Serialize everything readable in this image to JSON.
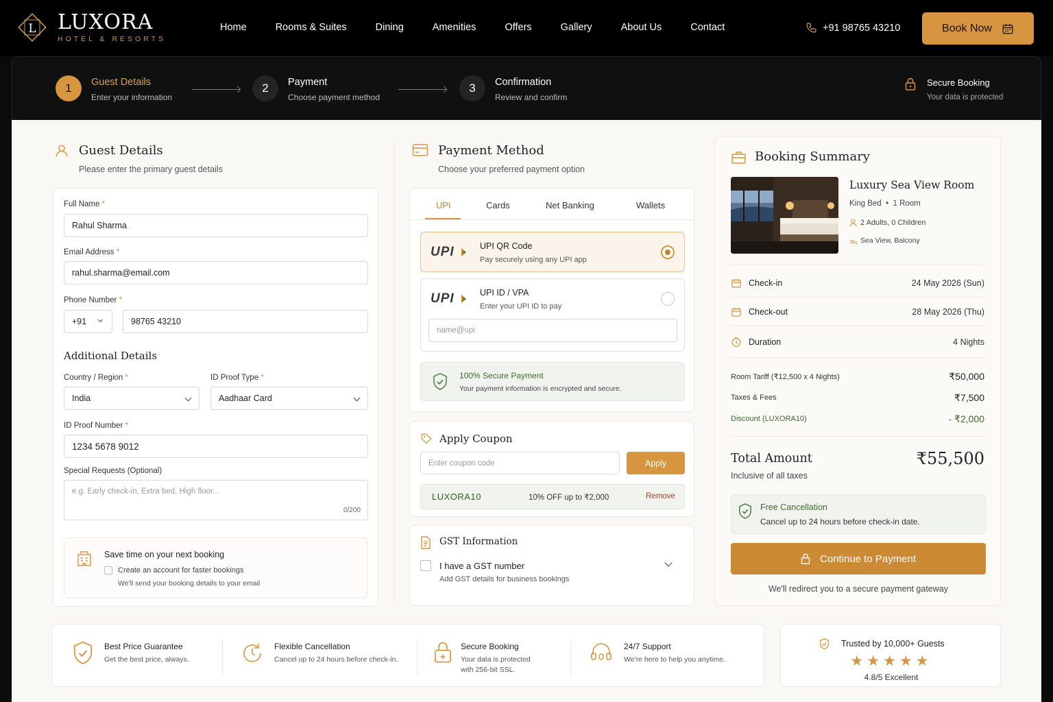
{
  "brand": {
    "name": "LUXORA",
    "tagline": "HOTEL & RESORTS",
    "monogram": "L",
    "accent": "#d7953f"
  },
  "nav": {
    "items": [
      "Home",
      "Rooms & Suites",
      "Dining",
      "Amenities",
      "Offers",
      "Gallery",
      "About Us",
      "Contact"
    ],
    "phone": "+91 98765 43210",
    "book_label": "Book Now"
  },
  "steps": [
    {
      "num": "1",
      "title": "Guest Details",
      "sub": "Enter your information",
      "active": true
    },
    {
      "num": "2",
      "title": "Payment",
      "sub": "Choose payment method",
      "active": false
    },
    {
      "num": "3",
      "title": "Confirmation",
      "sub": "Review and confirm",
      "active": false
    }
  ],
  "secure_booking": {
    "title": "Secure Booking",
    "sub": "Your data is protected"
  },
  "guest": {
    "title": "Guest Details",
    "sub": "Please enter the primary guest details",
    "full_name_label": "Full Name",
    "full_name": "Rahul Sharma",
    "email_label": "Email Address",
    "email": "rahul.sharma@email.com",
    "phone_label": "Phone Number",
    "country_code": "+91",
    "phone": "98765 43210",
    "additional_title": "Additional Details",
    "country_label": "Country / Region",
    "country": "India",
    "idtype_label": "ID Proof Type",
    "idtype": "Aadhaar Card",
    "idnum_label": "ID Proof Number",
    "idnum": "1234 5678 9012",
    "special_label": "Special Requests (Optional)",
    "special_placeholder": "e.g. Early check-in, Extra bed, High floor...",
    "special_count": "0/200",
    "save_title": "Save time on your next booking",
    "save_check": "Create an account for faster bookings",
    "save_sub": "We'll send your booking details to your email",
    "required_mark": "*"
  },
  "payment": {
    "title": "Payment Method",
    "sub": "Choose your preferred payment option",
    "tabs": [
      "UPI",
      "Cards",
      "Net Banking",
      "Wallets"
    ],
    "upi_logo": "UPI",
    "qr_title": "UPI QR Code",
    "qr_sub": "Pay securely using any UPI app",
    "vpa_title": "UPI ID / VPA",
    "vpa_sub": "Enter your UPI ID to pay",
    "vpa_placeholder": "name@upi",
    "secure_title": "100% Secure Payment",
    "secure_sub": "Your payment information is encrypted and secure."
  },
  "coupon": {
    "title": "Apply Coupon",
    "placeholder": "Enter coupon code",
    "apply": "Apply",
    "code": "LUXORA10",
    "desc": "10% OFF up to ₹2,000",
    "remove": "Remove"
  },
  "gst": {
    "title": "GST Information",
    "check": "I have a GST number",
    "sub": "Add GST details for business bookings"
  },
  "summary": {
    "title": "Booking Summary",
    "room": "Luxury Sea View Room",
    "bed": "King Bed",
    "rooms": "1 Room",
    "dot": "•",
    "guests": "2 Adults, 0 Children",
    "view": "Sea View, Balcony",
    "checkin_label": "Check-in",
    "checkin": "24 May 2026 (Sun)",
    "checkout_label": "Check-out",
    "checkout": "28 May 2026 (Thu)",
    "duration_label": "Duration",
    "duration": "4 Nights",
    "tariff_label": "Room Tariff (₹12,500 x 4 Nights)",
    "tariff": "₹50,000",
    "taxes_label": "Taxes & Fees",
    "taxes": "₹7,500",
    "discount_label": "Discount (LUXORA10)",
    "discount": "- ₹2,000",
    "total_label": "Total Amount",
    "total": "₹55,500",
    "total_sub": "Inclusive of all taxes",
    "cancel_title": "Free Cancellation",
    "cancel_sub": "Cancel up to 24 hours before check-in date.",
    "continue": "Continue to Payment",
    "redirect": "We'll redirect you to a secure payment gateway"
  },
  "features": [
    {
      "title": "Best Price Guarantee",
      "sub": "Get the best price, always."
    },
    {
      "title": "Flexible Cancellation",
      "sub": "Cancel up to 24 hours before check-in."
    },
    {
      "title": "Secure Booking",
      "sub": "Your data is protected",
      "sub2": "with 256-bit SSL."
    },
    {
      "title": "24/7 Support",
      "sub": "We're here to help you anytime."
    }
  ],
  "trust": {
    "title": "Trusted by 10,000+ Guests",
    "stars": "★★★★★",
    "rating": "4.8/5 Excellent",
    "rating_value": 4.8
  }
}
